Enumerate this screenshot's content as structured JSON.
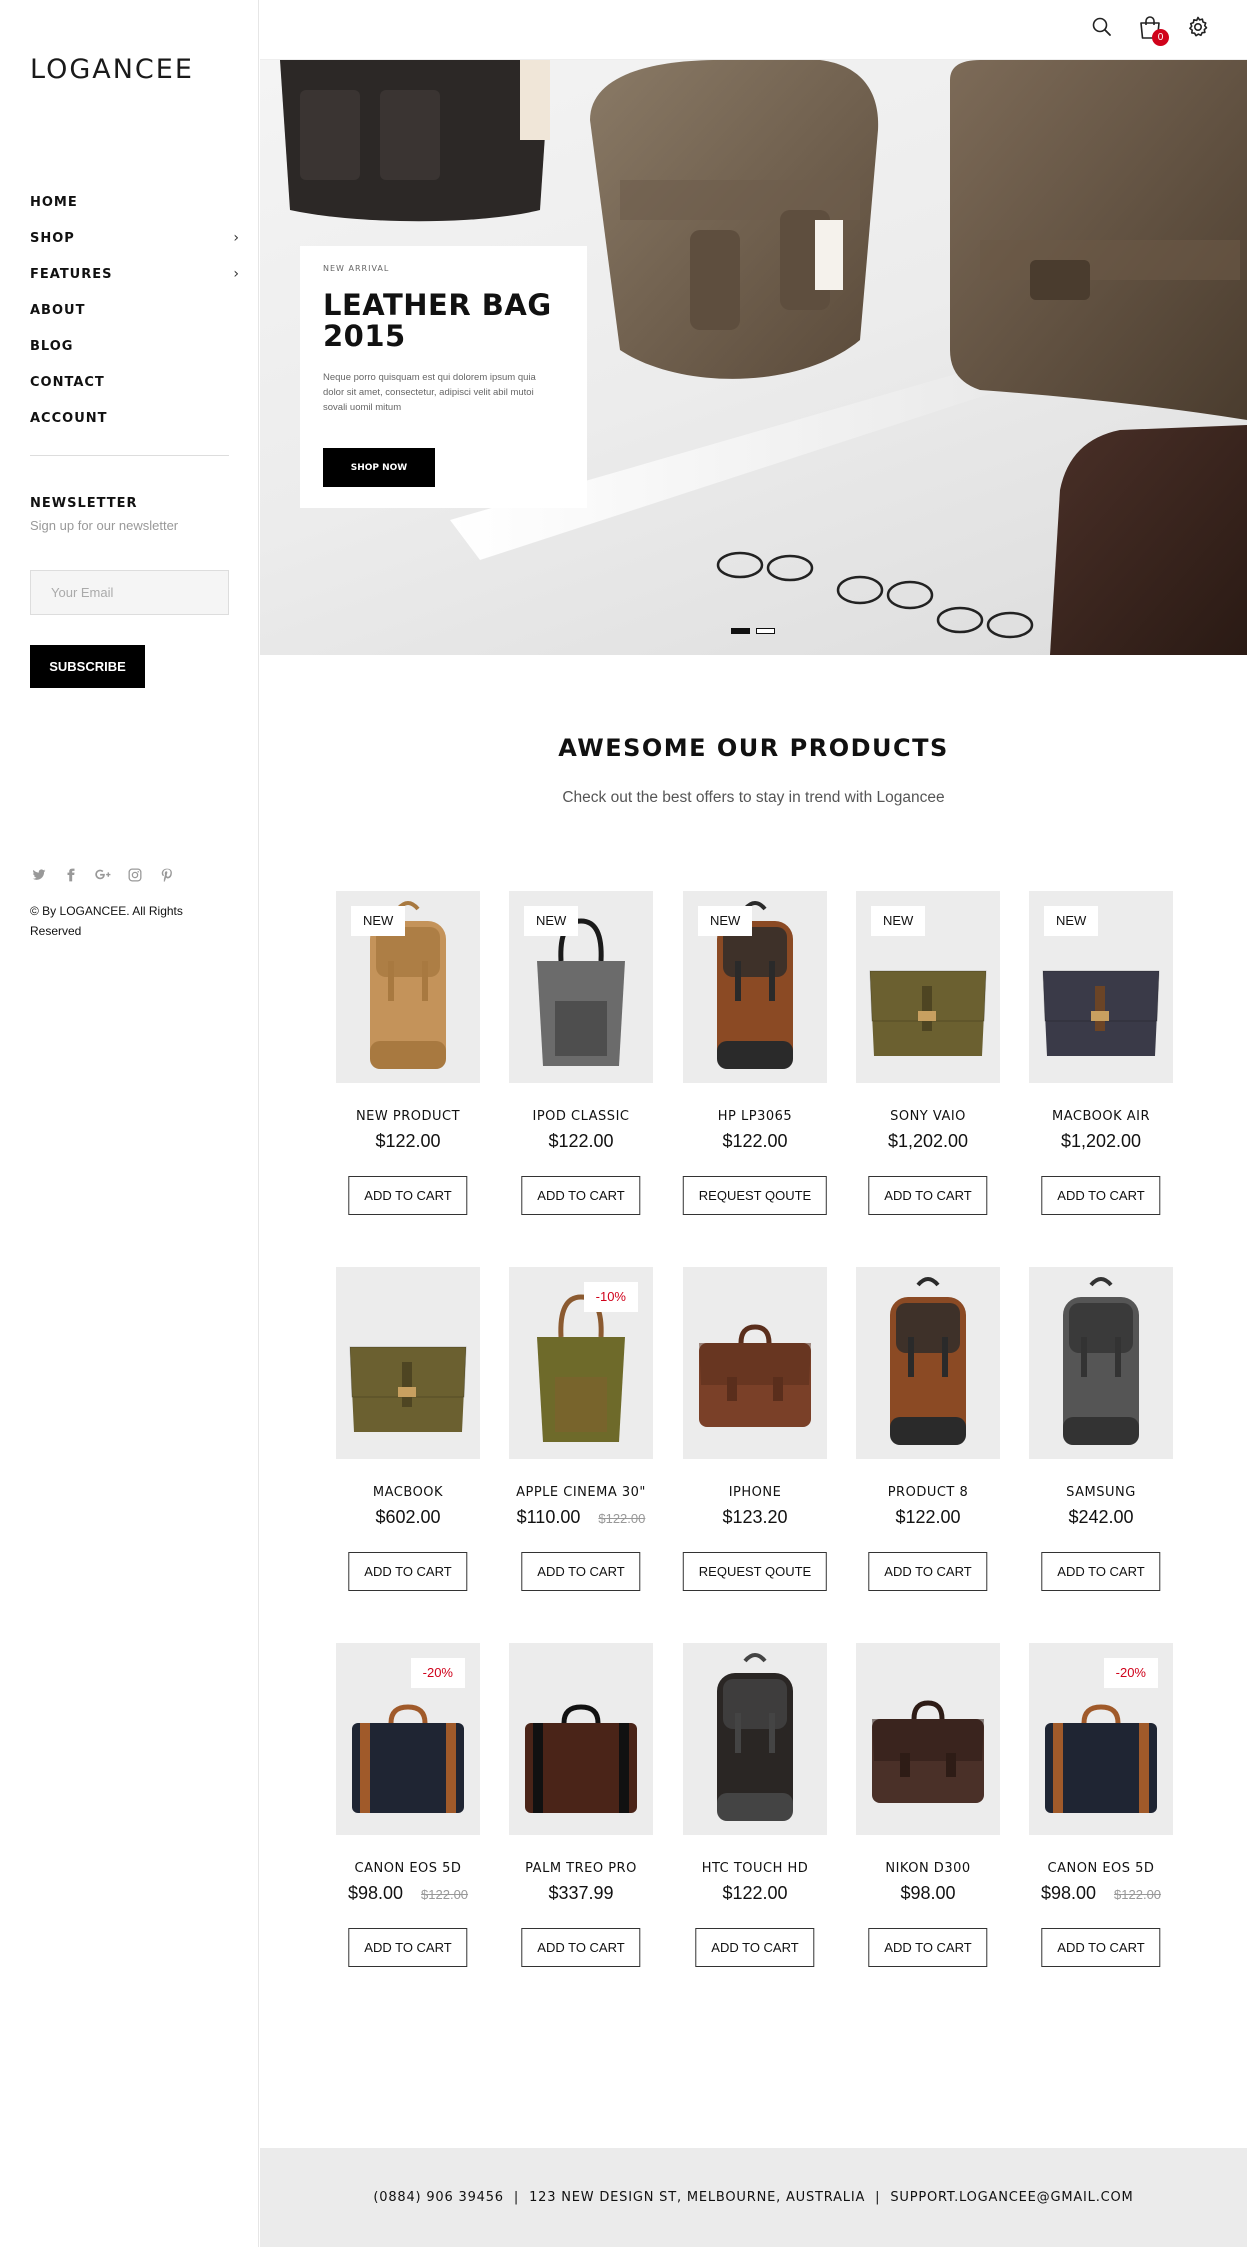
{
  "brand": {
    "logo": "LOGANCEE"
  },
  "nav": [
    {
      "label": "HOME",
      "has_children": false
    },
    {
      "label": "SHOP",
      "has_children": true
    },
    {
      "label": "FEATURES",
      "has_children": true
    },
    {
      "label": "ABOUT",
      "has_children": false
    },
    {
      "label": "BLOG",
      "has_children": false
    },
    {
      "label": "CONTACT",
      "has_children": false
    },
    {
      "label": "ACCOUNT",
      "has_children": false
    }
  ],
  "newsletter": {
    "title": "NEWSLETTER",
    "subtitle": "Sign up for our newsletter",
    "placeholder": "Your Email",
    "button": "SUBSCRIBE"
  },
  "social": [
    "twitter-icon",
    "facebook-icon",
    "google-plus-icon",
    "instagram-icon",
    "pinterest-icon"
  ],
  "copyright": "© By LOGANCEE. All Rights Reserved",
  "header": {
    "icons": [
      "search-icon",
      "cart-icon",
      "gear-icon"
    ],
    "cart_count": "0"
  },
  "hero": {
    "kicker": "NEW ARRIVAL",
    "title": "LEATHER BAG 2015",
    "text": "Neque porro quisquam est qui dolorem ipsum quia dolor sit amet, consectetur, adipisci velit abil mutoi sovali uomil mitum",
    "button": "SHOP NOW",
    "slides": 2,
    "active_slide": 1
  },
  "products_section": {
    "title": "AWESOME OUR PRODUCTS",
    "subtitle": "Check out the best offers to stay in trend with Logancee"
  },
  "products": [
    {
      "name": "NEW PRODUCT",
      "price": "$122.00",
      "old_price": "",
      "badge": "NEW",
      "badge_type": "new",
      "button": "ADD TO CART",
      "bag": "backpack-tan"
    },
    {
      "name": "IPOD CLASSIC",
      "price": "$122.00",
      "old_price": "",
      "badge": "NEW",
      "badge_type": "new",
      "button": "ADD TO CART",
      "bag": "tote-grey"
    },
    {
      "name": "HP LP3065",
      "price": "$122.00",
      "old_price": "",
      "badge": "NEW",
      "badge_type": "new",
      "button": "REQUEST QOUTE",
      "bag": "backpack-brown"
    },
    {
      "name": "SONY VAIO",
      "price": "$1,202.00",
      "old_price": "",
      "badge": "NEW",
      "badge_type": "new",
      "button": "ADD TO CART",
      "bag": "messenger-olive"
    },
    {
      "name": "MACBOOK AIR",
      "price": "$1,202.00",
      "old_price": "",
      "badge": "NEW",
      "badge_type": "new",
      "button": "ADD TO CART",
      "bag": "messenger-navy"
    },
    {
      "name": "MACBOOK",
      "price": "$602.00",
      "old_price": "",
      "badge": "",
      "badge_type": "",
      "button": "ADD TO CART",
      "bag": "messenger-olive"
    },
    {
      "name": "APPLE CINEMA 30\"",
      "price": "$110.00",
      "old_price": "$122.00",
      "badge": "-10%",
      "badge_type": "sale",
      "button": "ADD TO CART",
      "bag": "tote-olive"
    },
    {
      "name": "IPHONE",
      "price": "$123.20",
      "old_price": "",
      "badge": "",
      "badge_type": "",
      "button": "REQUEST QOUTE",
      "bag": "satchel-brown"
    },
    {
      "name": "PRODUCT 8",
      "price": "$122.00",
      "old_price": "",
      "badge": "",
      "badge_type": "",
      "button": "ADD TO CART",
      "bag": "backpack-brown"
    },
    {
      "name": "SAMSUNG",
      "price": "$242.00",
      "old_price": "",
      "badge": "",
      "badge_type": "",
      "button": "ADD TO CART",
      "bag": "backpack-grey"
    },
    {
      "name": "CANON EOS 5D",
      "price": "$98.00",
      "old_price": "$122.00",
      "badge": "-20%",
      "badge_type": "sale",
      "button": "ADD TO CART",
      "bag": "briefcase-navy"
    },
    {
      "name": "PALM TREO PRO",
      "price": "$337.99",
      "old_price": "",
      "badge": "",
      "badge_type": "",
      "button": "ADD TO CART",
      "bag": "briefcase-brown"
    },
    {
      "name": "HTC TOUCH HD",
      "price": "$122.00",
      "old_price": "",
      "badge": "",
      "badge_type": "",
      "button": "ADD TO CART",
      "bag": "backpack-black"
    },
    {
      "name": "NIKON D300",
      "price": "$98.00",
      "old_price": "",
      "badge": "",
      "badge_type": "",
      "button": "ADD TO CART",
      "bag": "satchel-darkbrown"
    },
    {
      "name": "CANON EOS 5D",
      "price": "$98.00",
      "old_price": "$122.00",
      "badge": "-20%",
      "badge_type": "sale",
      "button": "ADD TO CART",
      "bag": "briefcase-navy"
    }
  ],
  "footer": {
    "phone": "(0884) 906 39456",
    "address": "123 NEW DESIGN ST, MELBOURNE, AUSTRALIA",
    "email": "SUPPORT.LOGANCEE@GMAIL.COM"
  },
  "colors": {
    "accent": "#d0021b",
    "dark": "#000000",
    "footer_bg": "#ebebeb",
    "product_bg": "#ececec"
  }
}
